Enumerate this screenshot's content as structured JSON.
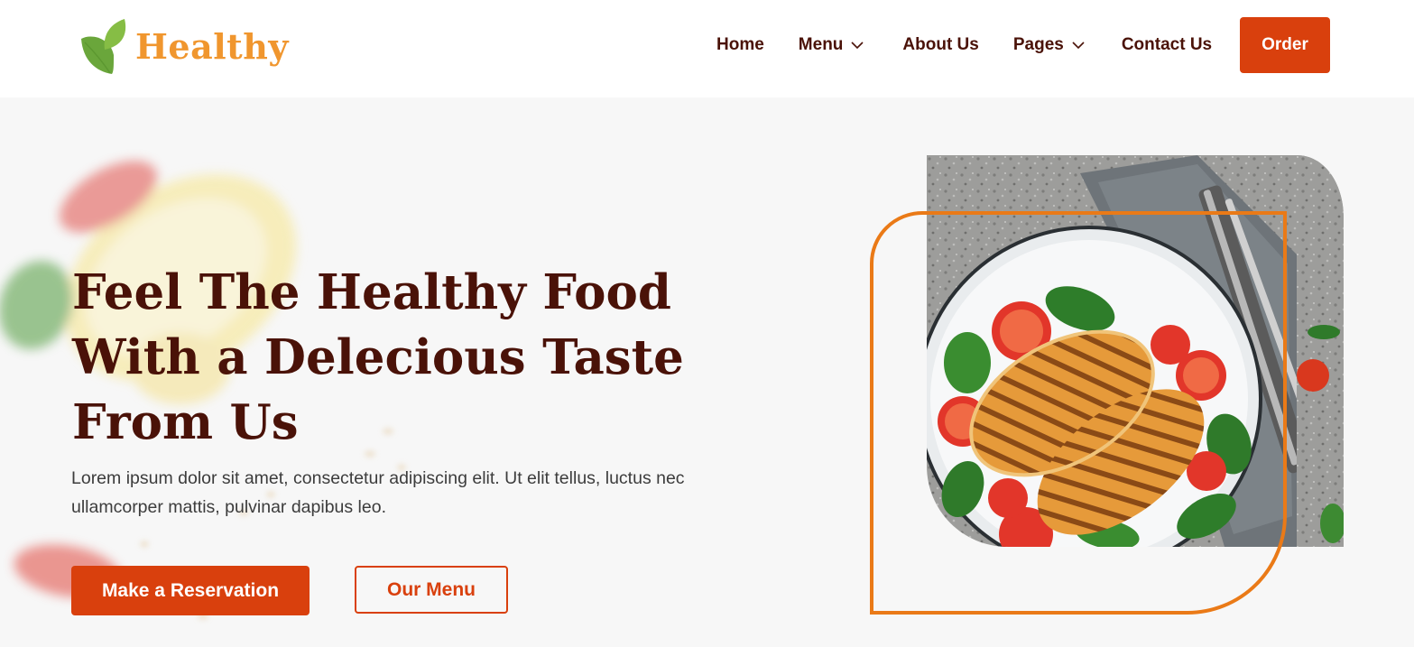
{
  "brand": {
    "name": "Healthy",
    "logo_icon": "leaf-icon",
    "leaf_colors": [
      "#6aa63b",
      "#86bd45"
    ]
  },
  "nav": {
    "items": [
      {
        "label": "Home",
        "has_dropdown": false
      },
      {
        "label": "Menu",
        "has_dropdown": true
      },
      {
        "label": "About Us",
        "has_dropdown": false
      },
      {
        "label": "Pages",
        "has_dropdown": true
      },
      {
        "label": "Contact Us",
        "has_dropdown": false
      }
    ],
    "dropdown_icon": "chevron-down-icon",
    "order_label": "Order"
  },
  "hero": {
    "title_lines": [
      "Feel The Healthy Food",
      "With a Delecious Taste",
      "From Us"
    ],
    "description": "Lorem ipsum dolor sit amet, consectetur adipiscing elit. Ut elit tellus, luctus nec ullamcorper mattis, pulvinar dapibus leo.",
    "primary_button": "Make a Reservation",
    "secondary_button": "Our Menu",
    "image_subject": "grilled chicken breasts with spinach and cherry tomatoes on a plate"
  },
  "colors": {
    "primary": "#d9400d",
    "heading": "#4a1208",
    "logo_text": "#f0962e",
    "frame": "#ea7a17",
    "hero_bg": "#f7f7f7"
  }
}
